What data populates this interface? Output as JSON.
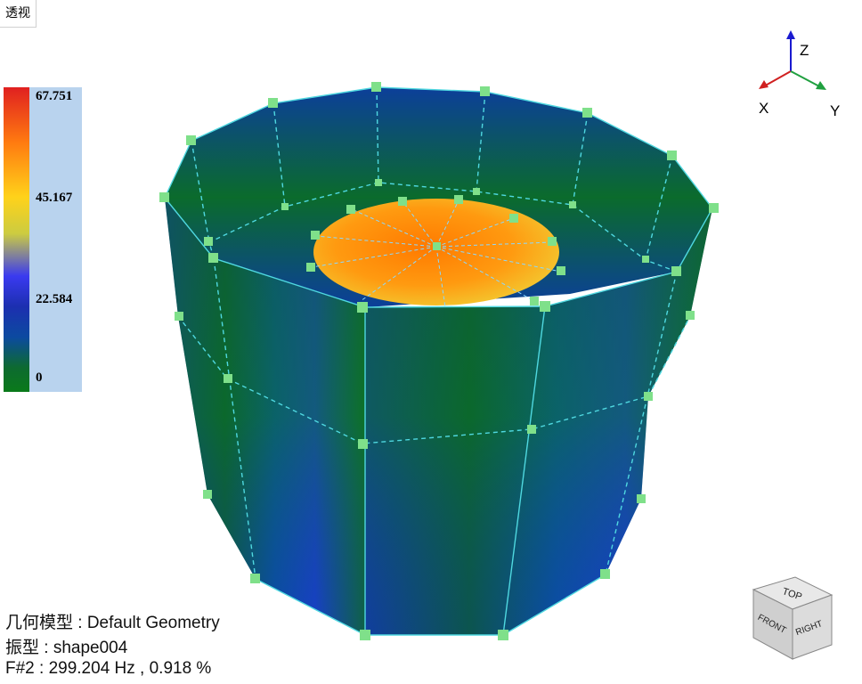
{
  "view_tab": {
    "label": "透视"
  },
  "legend": {
    "max": "67.751",
    "mid_high": "45.167",
    "mid_low": "22.584",
    "min": "0",
    "colors": [
      "#e02020",
      "#ff7a10",
      "#ffd21a",
      "#3a3af0",
      "#0c4aa0",
      "#0a7a1a"
    ]
  },
  "info": {
    "geometry": "几何模型 : Default Geometry",
    "mode_shape": "振型 : shape004",
    "frequency": "F#2 : 299.204 Hz , 0.918 %"
  },
  "triad": {
    "z": "Z",
    "x": "X",
    "y": "Y"
  },
  "viewcube": {
    "top": "TOP",
    "front": "FRONT",
    "right": "RIGHT"
  },
  "model": {
    "node_color": "#7fe08a",
    "edge_color": "#4fd8e0",
    "mesh_color": "#0c3fa0"
  }
}
